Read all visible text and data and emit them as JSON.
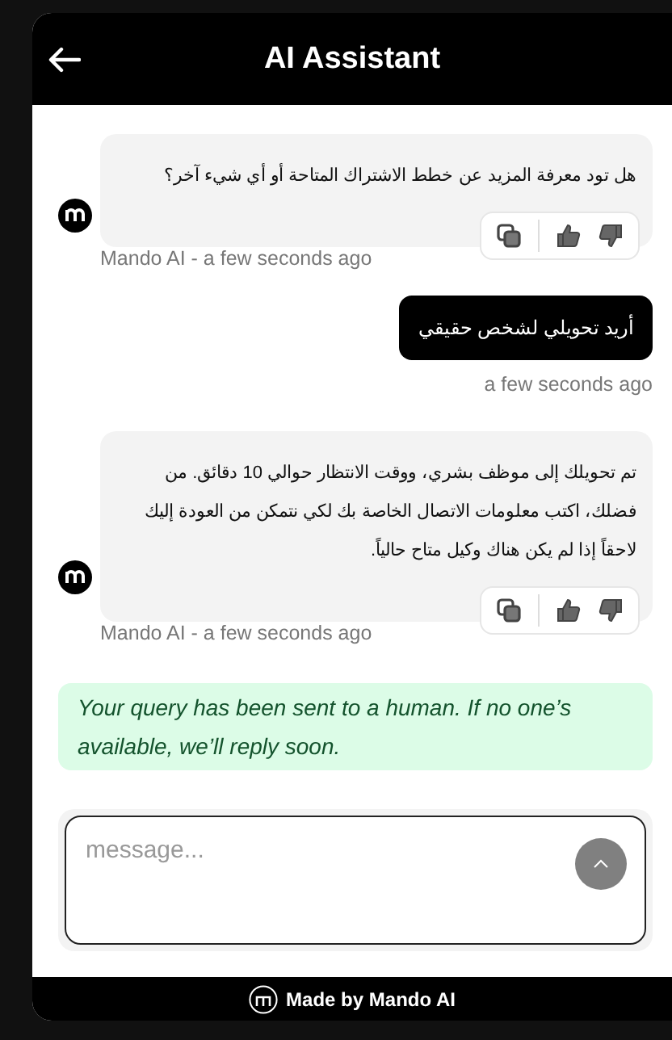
{
  "header": {
    "title": "AI Assistant"
  },
  "messages": [
    {
      "kind": "bot",
      "text": "هل تود معرفة المزيد عن خطط الاشتراك المتاحة أو أي شيء آخر؟",
      "meta": "Mando AI - a few seconds ago"
    },
    {
      "kind": "user",
      "text": "أريد تحويلي لشخص حقيقي",
      "meta": "a few seconds ago"
    },
    {
      "kind": "bot",
      "text": "تم تحويلك إلى موظف بشري، ووقت الانتظار حوالي 10 دقائق. من فضلك، اكتب معلومات الاتصال الخاصة بك لكي نتمكن من العودة إليك لاحقاً إذا لم يكن هناك وكيل متاح حالياً.",
      "meta": "Mando AI - a few seconds ago"
    },
    {
      "kind": "notice",
      "text": "Your query has been sent to a human. If no one’s available, we’ll reply soon."
    }
  ],
  "composer": {
    "placeholder": "message..."
  },
  "footer": {
    "text": "Made by Mando AI"
  }
}
